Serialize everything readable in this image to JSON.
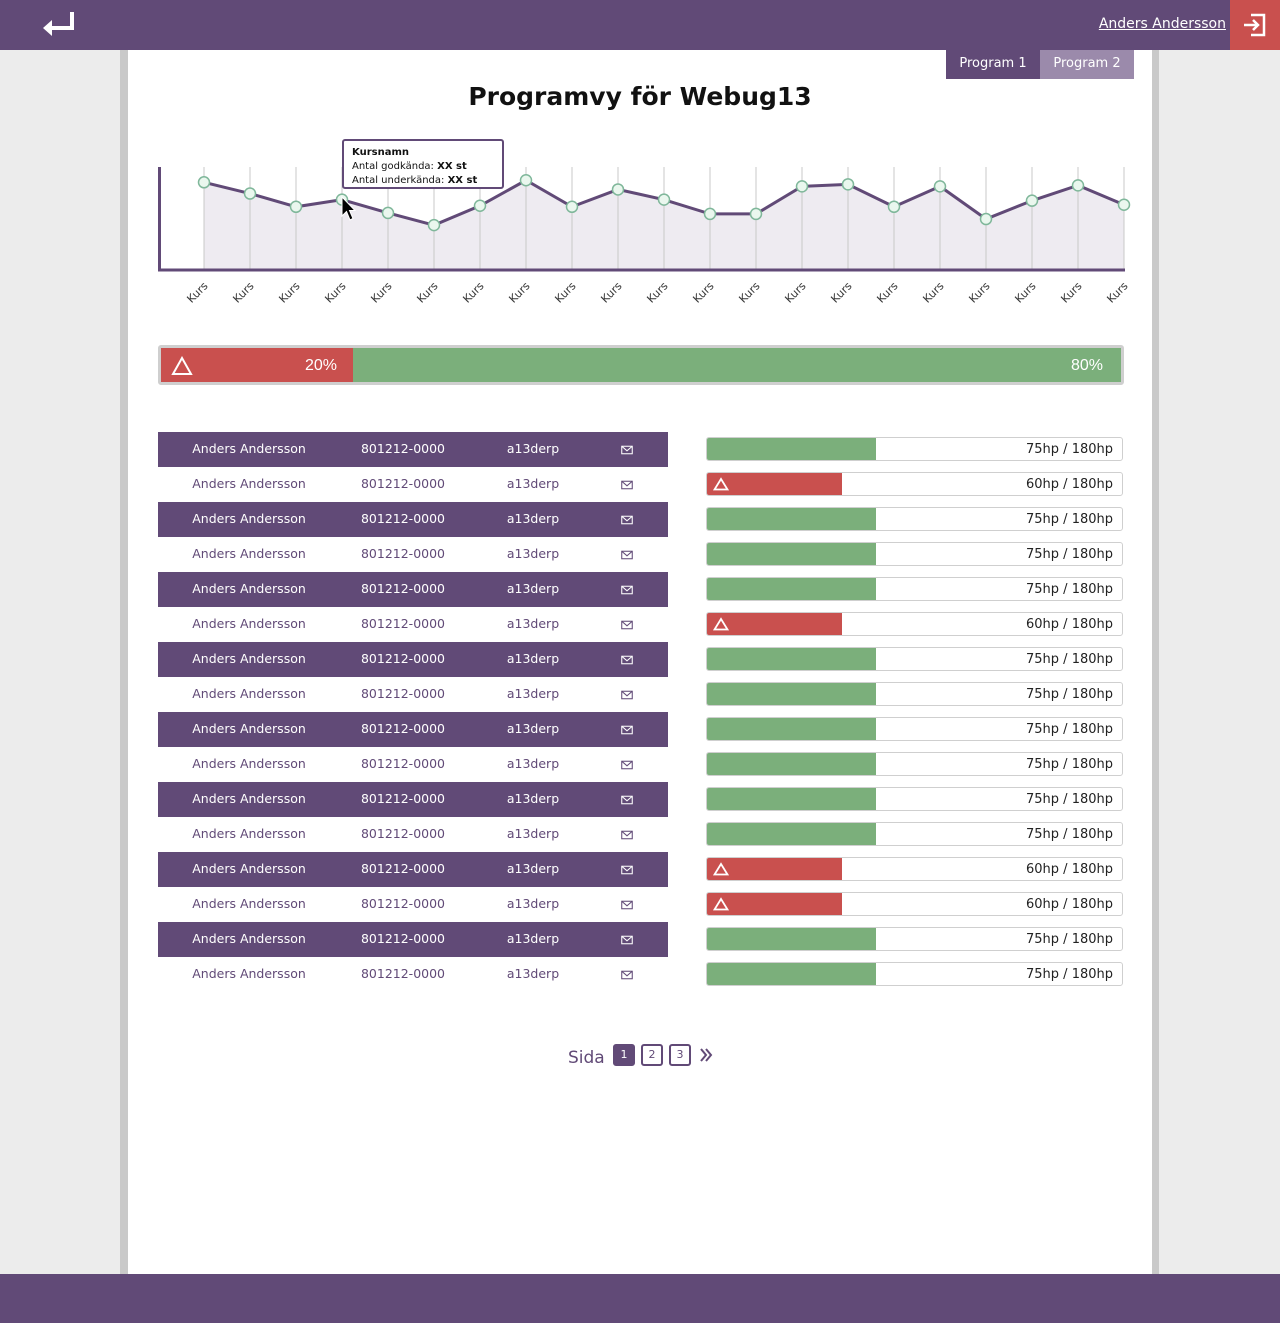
{
  "header": {
    "user_name": "Anders Andersson",
    "back_icon": "return-arrow-icon",
    "logout_icon": "logout-icon"
  },
  "tabs": [
    {
      "label": "Program 1",
      "active": true
    },
    {
      "label": "Program 2",
      "active": false
    }
  ],
  "page_title": "Programvy för Webug13",
  "chart_data": {
    "type": "line",
    "categories": [
      "Kurs",
      "Kurs",
      "Kurs",
      "Kurs",
      "Kurs",
      "Kurs",
      "Kurs",
      "Kurs",
      "Kurs",
      "Kurs",
      "Kurs",
      "Kurs",
      "Kurs",
      "Kurs",
      "Kurs",
      "Kurs",
      "Kurs",
      "Kurs",
      "Kurs",
      "Kurs",
      "Kurs"
    ],
    "values": [
      85,
      74,
      61,
      68,
      55,
      43,
      62,
      87,
      61,
      78,
      68,
      54,
      54,
      81,
      83,
      61,
      81,
      49,
      67,
      82,
      63
    ],
    "ylim": [
      0,
      100
    ],
    "grid": "vertical",
    "colors": {
      "line": "#614a77",
      "area": "#eeebf1",
      "marker_fill": "#eaf7ee",
      "marker_stroke": "#7fb79a"
    }
  },
  "tooltip": {
    "title": "Kursnamn",
    "passed_label": "Antal godkända:",
    "passed_value": "XX st",
    "failed_label": "Antal underkända:",
    "failed_value": "XX st"
  },
  "summary_bar": {
    "fail_percent": 20,
    "pass_percent": 80,
    "fail_label": "20%",
    "pass_label": "80%",
    "icon": "warning-triangle-icon"
  },
  "students": [
    {
      "name": "Anders Andersson",
      "pnr": "801212-0000",
      "user": "a13derp",
      "points": 75,
      "credits": "75hp / 180hp",
      "warning": false
    },
    {
      "name": "Anders Andersson",
      "pnr": "801212-0000",
      "user": "a13derp",
      "points": 60,
      "credits": "60hp / 180hp",
      "warning": true
    },
    {
      "name": "Anders Andersson",
      "pnr": "801212-0000",
      "user": "a13derp",
      "points": 75,
      "credits": "75hp / 180hp",
      "warning": false
    },
    {
      "name": "Anders Andersson",
      "pnr": "801212-0000",
      "user": "a13derp",
      "points": 75,
      "credits": "75hp / 180hp",
      "warning": false
    },
    {
      "name": "Anders Andersson",
      "pnr": "801212-0000",
      "user": "a13derp",
      "points": 75,
      "credits": "75hp / 180hp",
      "warning": false
    },
    {
      "name": "Anders Andersson",
      "pnr": "801212-0000",
      "user": "a13derp",
      "points": 60,
      "credits": "60hp / 180hp",
      "warning": true
    },
    {
      "name": "Anders Andersson",
      "pnr": "801212-0000",
      "user": "a13derp",
      "points": 75,
      "credits": "75hp / 180hp",
      "warning": false
    },
    {
      "name": "Anders Andersson",
      "pnr": "801212-0000",
      "user": "a13derp",
      "points": 75,
      "credits": "75hp / 180hp",
      "warning": false
    },
    {
      "name": "Anders Andersson",
      "pnr": "801212-0000",
      "user": "a13derp",
      "points": 75,
      "credits": "75hp / 180hp",
      "warning": false
    },
    {
      "name": "Anders Andersson",
      "pnr": "801212-0000",
      "user": "a13derp",
      "points": 75,
      "credits": "75hp / 180hp",
      "warning": false
    },
    {
      "name": "Anders Andersson",
      "pnr": "801212-0000",
      "user": "a13derp",
      "points": 75,
      "credits": "75hp / 180hp",
      "warning": false
    },
    {
      "name": "Anders Andersson",
      "pnr": "801212-0000",
      "user": "a13derp",
      "points": 75,
      "credits": "75hp / 180hp",
      "warning": false
    },
    {
      "name": "Anders Andersson",
      "pnr": "801212-0000",
      "user": "a13derp",
      "points": 60,
      "credits": "60hp / 180hp",
      "warning": true
    },
    {
      "name": "Anders Andersson",
      "pnr": "801212-0000",
      "user": "a13derp",
      "points": 60,
      "credits": "60hp / 180hp",
      "warning": true
    },
    {
      "name": "Anders Andersson",
      "pnr": "801212-0000",
      "user": "a13derp",
      "points": 75,
      "credits": "75hp / 180hp",
      "warning": false
    },
    {
      "name": "Anders Andersson",
      "pnr": "801212-0000",
      "user": "a13derp",
      "points": 75,
      "credits": "75hp / 180hp",
      "warning": false
    }
  ],
  "credit_scale": {
    "shown_max": 120
  },
  "mail_icon": "envelope-icon",
  "pagination": {
    "label": "Sida",
    "pages": [
      "1",
      "2",
      "3"
    ],
    "current": "1",
    "next_icon": "double-chevron-right-icon"
  },
  "colors": {
    "brand": "#614a77",
    "brand_light": "#9b8aab",
    "danger": "#c9504e",
    "success": "#7baf7b"
  }
}
